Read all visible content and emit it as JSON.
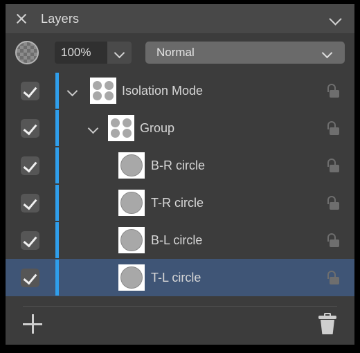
{
  "header": {
    "title": "Layers",
    "close_icon": "close-icon",
    "collapse_icon": "chevron-down-icon"
  },
  "toolbar": {
    "swatch_icon": "checkerboard-circle-icon",
    "opacity_value": "100%",
    "opacity_arrow_icon": "chevron-down-icon",
    "blend_mode": "Normal",
    "blend_arrow_icon": "chevron-down-icon"
  },
  "layers": [
    {
      "label": "Isolation Mode",
      "indent": 0,
      "visible": true,
      "expanded": true,
      "has_children": true,
      "selected": false,
      "locked": false,
      "thumb": "group",
      "lock_icon": "unlocked-padlock-icon"
    },
    {
      "label": "Group",
      "indent": 1,
      "visible": true,
      "expanded": true,
      "has_children": true,
      "selected": false,
      "locked": false,
      "thumb": "group",
      "lock_icon": "unlocked-padlock-icon"
    },
    {
      "label": "B-R circle",
      "indent": 2,
      "visible": true,
      "expanded": false,
      "has_children": false,
      "selected": false,
      "locked": false,
      "thumb": "single",
      "lock_icon": "unlocked-padlock-icon"
    },
    {
      "label": "T-R circle",
      "indent": 2,
      "visible": true,
      "expanded": false,
      "has_children": false,
      "selected": false,
      "locked": false,
      "thumb": "single",
      "lock_icon": "unlocked-padlock-icon"
    },
    {
      "label": "B-L circle",
      "indent": 2,
      "visible": true,
      "expanded": false,
      "has_children": false,
      "selected": false,
      "locked": false,
      "thumb": "single",
      "lock_icon": "unlocked-padlock-icon"
    },
    {
      "label": "T-L circle",
      "indent": 2,
      "visible": true,
      "expanded": false,
      "has_children": false,
      "selected": true,
      "locked": false,
      "thumb": "single",
      "lock_icon": "unlocked-padlock-icon"
    }
  ],
  "scrollbar": {
    "thumb_top": 0,
    "thumb_height": 50
  },
  "footer": {
    "add_icon": "plus-icon",
    "delete_icon": "trash-icon"
  },
  "colors": {
    "panel_bg": "#3c3c3c",
    "header_bg": "#484848",
    "selection_bg": "#3f5576",
    "accent_blue": "#2f9eeb",
    "text": "#d6d6d6",
    "lock_gray": "#6e6e6e"
  }
}
